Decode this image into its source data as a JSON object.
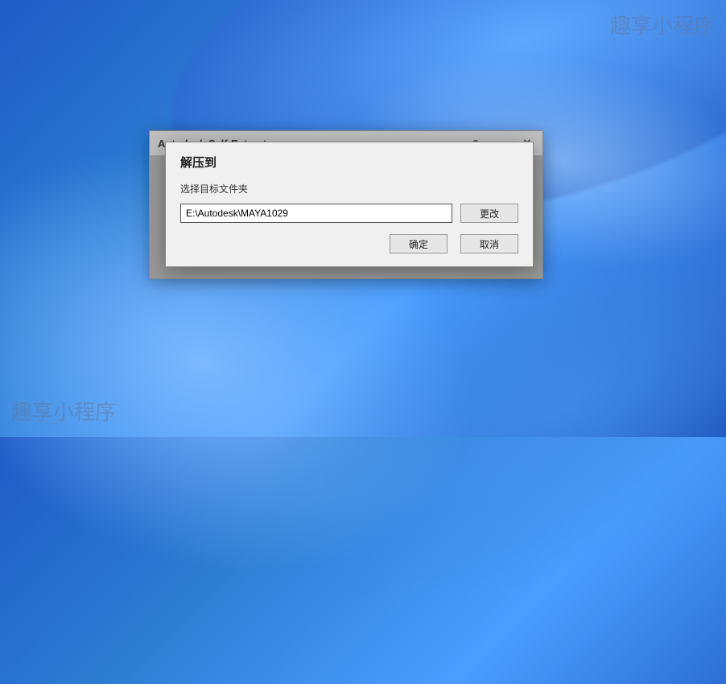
{
  "watermark": {
    "text": "趣享小程序"
  },
  "outerWindow": {
    "title": "Autodesk Self-Extract"
  },
  "dialog": {
    "title": "解压到",
    "label": "选择目标文件夹",
    "path": "E:\\Autodesk\\MAYA1029",
    "changeBtn": "更改",
    "okBtn": "确定",
    "cancelBtn": "取消"
  }
}
